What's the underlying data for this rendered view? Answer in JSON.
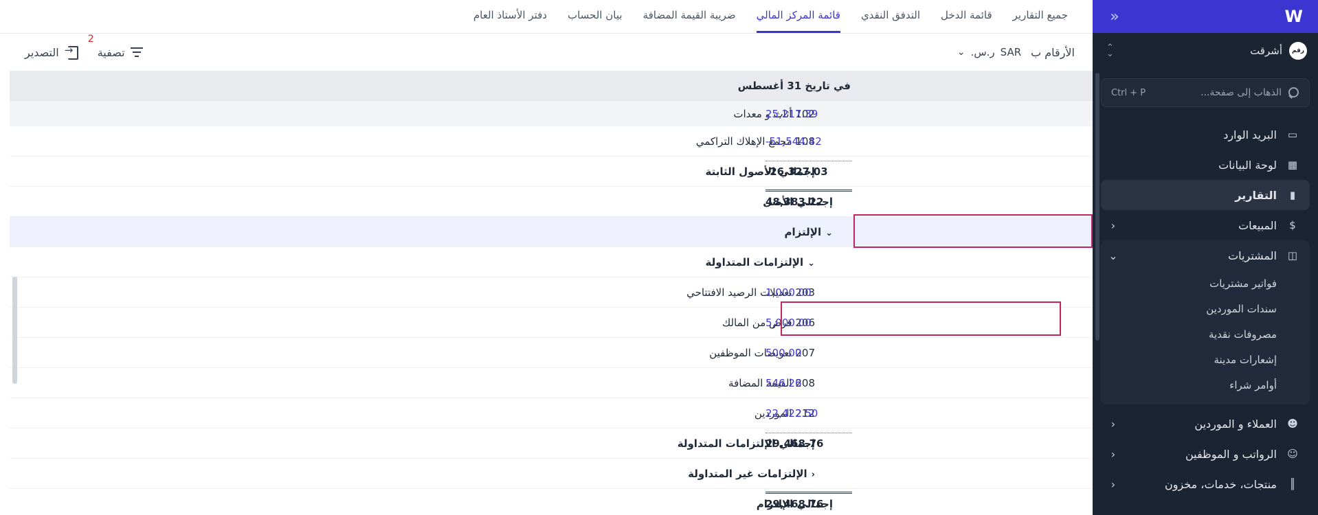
{
  "sidebar": {
    "org_name": "أشرقت",
    "org_avatar": "رقم",
    "search_placeholder": "الذهاب إلى صفحة...",
    "search_shortcut": "Ctrl + P",
    "nav": {
      "inbox": "البريد الوارد",
      "dashboard": "لوحة البيانات",
      "reports": "التقارير",
      "sales": "المبيعات",
      "purchases": "المشتريات",
      "purchase_sub": [
        "فواتير مشتريات",
        "سندات الموردين",
        "مصروفات نقدية",
        "إشعارات مدينة",
        "أوامر شراء"
      ],
      "customers_suppliers": "العملاء و الموردين",
      "payroll": "الرواتب و الموظفين",
      "products": "منتجات، خدمات، مخزون"
    }
  },
  "tabs": [
    "جميع التقارير",
    "قائمة الدخل",
    "التدفق النقدي",
    "قائمة المركز المالي",
    "ضريبة القيمة المضافة",
    "بيان الحساب",
    "دفتر الأستاذ العام"
  ],
  "active_tab_index": 3,
  "toolbar": {
    "numbers_in_label": "الأرقام ب",
    "currency_code": "SAR",
    "currency_symbol": "ر.س.",
    "filter_label": "تصفية",
    "filter_count": "2",
    "export_label": "التصدير"
  },
  "report": {
    "date_header": "في تاريخ 31 أغسطس",
    "rows": {
      "r102": {
        "label": "102 أثاث و معدات",
        "amount": "25,217.39"
      },
      "r108": {
        "label": "108 مجمع الإهلاك التراكمي",
        "amount": "-51,544.42"
      },
      "fixed_total": {
        "label": "إجمالي الأصول الثابتة",
        "amount": "-26,327.03"
      },
      "assets_total": {
        "label": "إجمالي الأصل",
        "amount": "48,383.22"
      },
      "liability": {
        "label": "الإلتزام"
      },
      "current_liab": {
        "label": "الإلتزامات المتداولة"
      },
      "r203": {
        "label": "203 تعديلات الرصيد الافتتاحي",
        "amount": "1,000.00"
      },
      "r206": {
        "label": "206 قرض من المالك",
        "amount": "5,000.00"
      },
      "r207": {
        "label": "207 تعويضات الموظفين",
        "amount": "500.00"
      },
      "r208": {
        "label": "208 القيمة المضافة",
        "amount": "546.26"
      },
      "r212": {
        "label": "212 الموردين",
        "amount": "22,422.50"
      },
      "current_total": {
        "label": "إجمالي الإلتزامات المتداولة",
        "amount": "29,468.76"
      },
      "noncurrent_liab": {
        "label": "الإلتزامات غير المتداولة"
      },
      "liab_total": {
        "label": "إجمالي الإلتزام",
        "amount": "29,468.76"
      }
    }
  },
  "colors": {
    "accent": "#3b36d1",
    "sidebar_bg": "#1b2433",
    "highlight_border": "#c0255f",
    "amount_link": "#4338ca"
  }
}
